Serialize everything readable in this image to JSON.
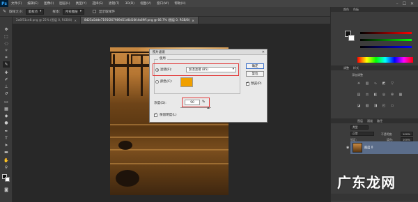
{
  "app": {
    "logo": "Ps",
    "menu": [
      "文件(F)",
      "编辑(E)",
      "图像(I)",
      "图层(L)",
      "类型(Y)",
      "选择(S)",
      "滤镜(T)",
      "3D(D)",
      "视图(V)",
      "窗口(W)",
      "帮助(H)"
    ],
    "window_controls": [
      "–",
      "☐",
      "✕"
    ]
  },
  "options_bar": {
    "brush_size_label": "取样大小:",
    "brush_size_value": "取样点",
    "sample_label": "样本:",
    "sample_value": "所有图层",
    "show_ring_label": "显示取样环"
  },
  "tabs": [
    {
      "label": "2a6f51ce8.png @ 25% (图层 0, RGB/8)",
      "close": "×",
      "active": false
    },
    {
      "label": "8425a5dde7195f267989d51d6d16fcfa69ff.png @ 66.7% (图层 0, RGB/8)",
      "close": "×",
      "active": true
    }
  ],
  "dialog": {
    "title": "照片滤镜",
    "close": "✕",
    "group_label": "使用",
    "filter_label": "滤镜(F):",
    "filter_value": "加温滤镜 (85)",
    "color_label": "颜色(C):",
    "swatch_color": "#f0a000",
    "density_label": "浓度(D):",
    "density_value": "90",
    "density_unit": "%",
    "density_level": 90,
    "preserve_label": "保留明度(L)",
    "preserve_checked": true,
    "ok_label": "确定",
    "cancel_label": "复位",
    "preview_label": "预览(P)",
    "preview_checked": true
  },
  "right_panel": {
    "color_tabs": [
      "颜色",
      "色板"
    ],
    "adjust_tabs": [
      "调整",
      "样式"
    ],
    "adjust_title": "添加调整",
    "layers_tabs": [
      "图层",
      "通道",
      "路径"
    ],
    "kind_label": "类型",
    "blend_mode": "正常",
    "opacity_label": "不透明度:",
    "opacity_value": "100%",
    "lock_label": "锁定:",
    "fill_label": "填充:",
    "fill_value": "100%",
    "layer_name": "图层 0"
  },
  "watermark": "广东龙网"
}
